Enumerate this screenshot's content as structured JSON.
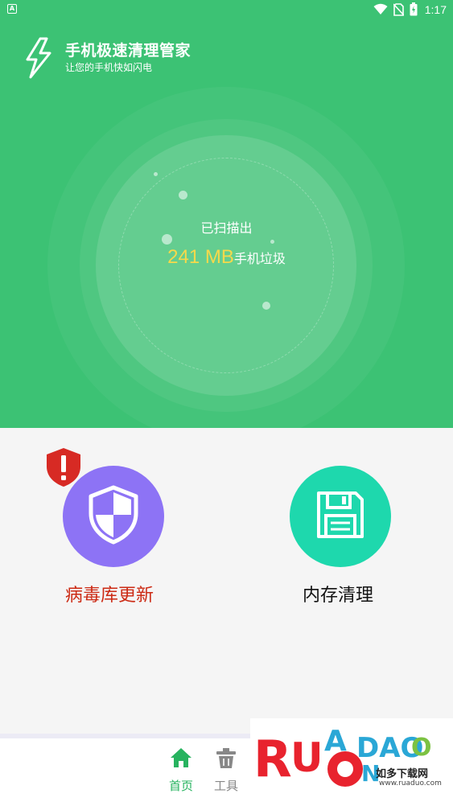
{
  "status_bar": {
    "left_icon": "A",
    "time": "1:17",
    "icons": [
      "wifi-icon",
      "no-sim-icon",
      "battery-icon"
    ]
  },
  "header": {
    "title": "手机极速清理管家",
    "subtitle": "让您的手机快如闪电",
    "icon": "lightning-icon"
  },
  "scan": {
    "label": "已扫描出",
    "value": "241 MB",
    "unit": "手机垃圾"
  },
  "features": [
    {
      "label": "病毒库更新",
      "icon": "shield-icon",
      "badge_icon": "alert-shield-icon",
      "circle_color": "#8d73f5",
      "label_color": "#cc2a14"
    },
    {
      "label": "内存清理",
      "icon": "floppy-disk-icon",
      "circle_color": "#1ed8ad",
      "label_color": "#111111"
    }
  ],
  "bottom_nav": {
    "items": [
      {
        "label": "首页",
        "icon": "home-icon",
        "active": true,
        "color": "#27b35f"
      },
      {
        "label": "工具",
        "icon": "trash-icon",
        "active": false,
        "color": "#888888"
      }
    ]
  },
  "watermark": {
    "logo_text": "RUANDUO",
    "subtitle": "如多下载网",
    "url": "www.ruaduo.com"
  },
  "colors": {
    "primary_green": "#3cc274",
    "highlight_yellow": "#f5d94b"
  }
}
